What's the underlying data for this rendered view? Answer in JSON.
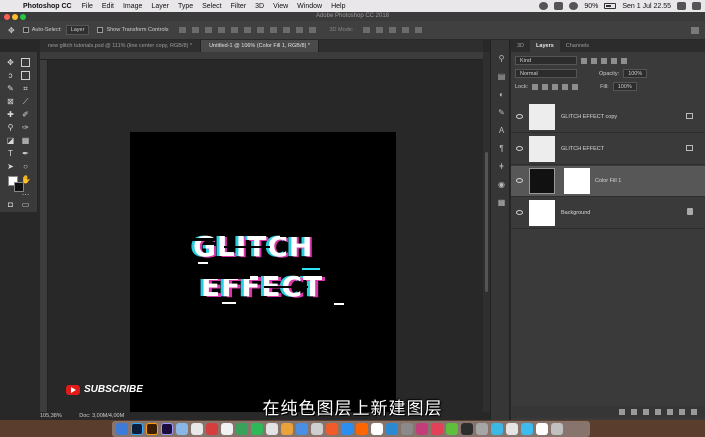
{
  "menubar": {
    "app_name": "Photoshop CC",
    "menus": [
      "File",
      "Edit",
      "Image",
      "Layer",
      "Type",
      "Select",
      "Filter",
      "3D",
      "View",
      "Window",
      "Help"
    ],
    "battery": "90%",
    "datetime": "Sen 1 Jul  22.55"
  },
  "window": {
    "title": "Adobe Photoshop CC 2018"
  },
  "options": {
    "auto_select_label": "Auto-Select:",
    "auto_select_value": "Layer",
    "transform_label": "Show Transform Controls",
    "mode_label": "3D Mode:"
  },
  "tabs": [
    {
      "label": "new glitch tutorials.psd @ 111% (line center copy, RGB/8) *"
    },
    {
      "label": "Untitled-1 @ 106% (Color Fill 1, RGB/8) *"
    }
  ],
  "canvas": {
    "line1": "GLITCH",
    "line2": "EFFECT"
  },
  "status": {
    "zoom": "105,38%",
    "doc": "Doc: 3,00M/4,00M"
  },
  "panel": {
    "tabs": [
      "3D",
      "Layers",
      "Channels"
    ],
    "kind_label": "Kind",
    "blend_mode": "Normal",
    "opacity_label": "Opacity:",
    "opacity_value": "100%",
    "lock_label": "Lock:",
    "fill_label": "Fill:",
    "fill_value": "100%",
    "layers": [
      {
        "name": "GLITCH EFFECT copy"
      },
      {
        "name": "GLITCH EFFECT"
      },
      {
        "name": "Color Fill 1"
      },
      {
        "name": "Background"
      }
    ]
  },
  "overlay": {
    "subscribe": "SUBSCRIBE",
    "subtitle": "在纯色图层上新建图层"
  },
  "colors": {
    "cyan_glitch": "#2fe4f5",
    "magenta_glitch": "#f23ec0",
    "youtube_red": "#e21a1a"
  }
}
